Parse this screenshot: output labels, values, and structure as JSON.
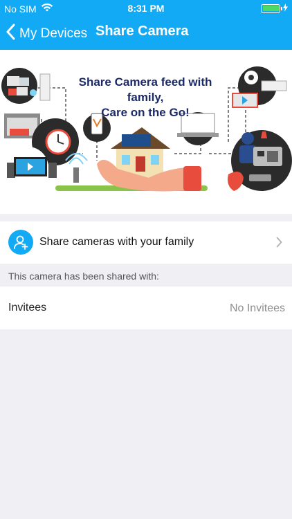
{
  "status_bar": {
    "carrier": "No SIM",
    "time": "8:31 PM",
    "battery_level": 1.0
  },
  "nav": {
    "back_label": "My Devices",
    "title": "Share Camera"
  },
  "banner": {
    "headline_line1": "Share Camera feed with family,",
    "headline_line2": "Care on the Go!"
  },
  "share_row": {
    "label": "Share cameras with your family"
  },
  "section": {
    "header": "This camera has been shared with:"
  },
  "invitees": {
    "label": "Invitees",
    "value": "No Invitees"
  },
  "colors": {
    "primary": "#12a9f5",
    "background": "#efeff4",
    "battery": "#4cd964",
    "headline": "#1c2a68"
  }
}
